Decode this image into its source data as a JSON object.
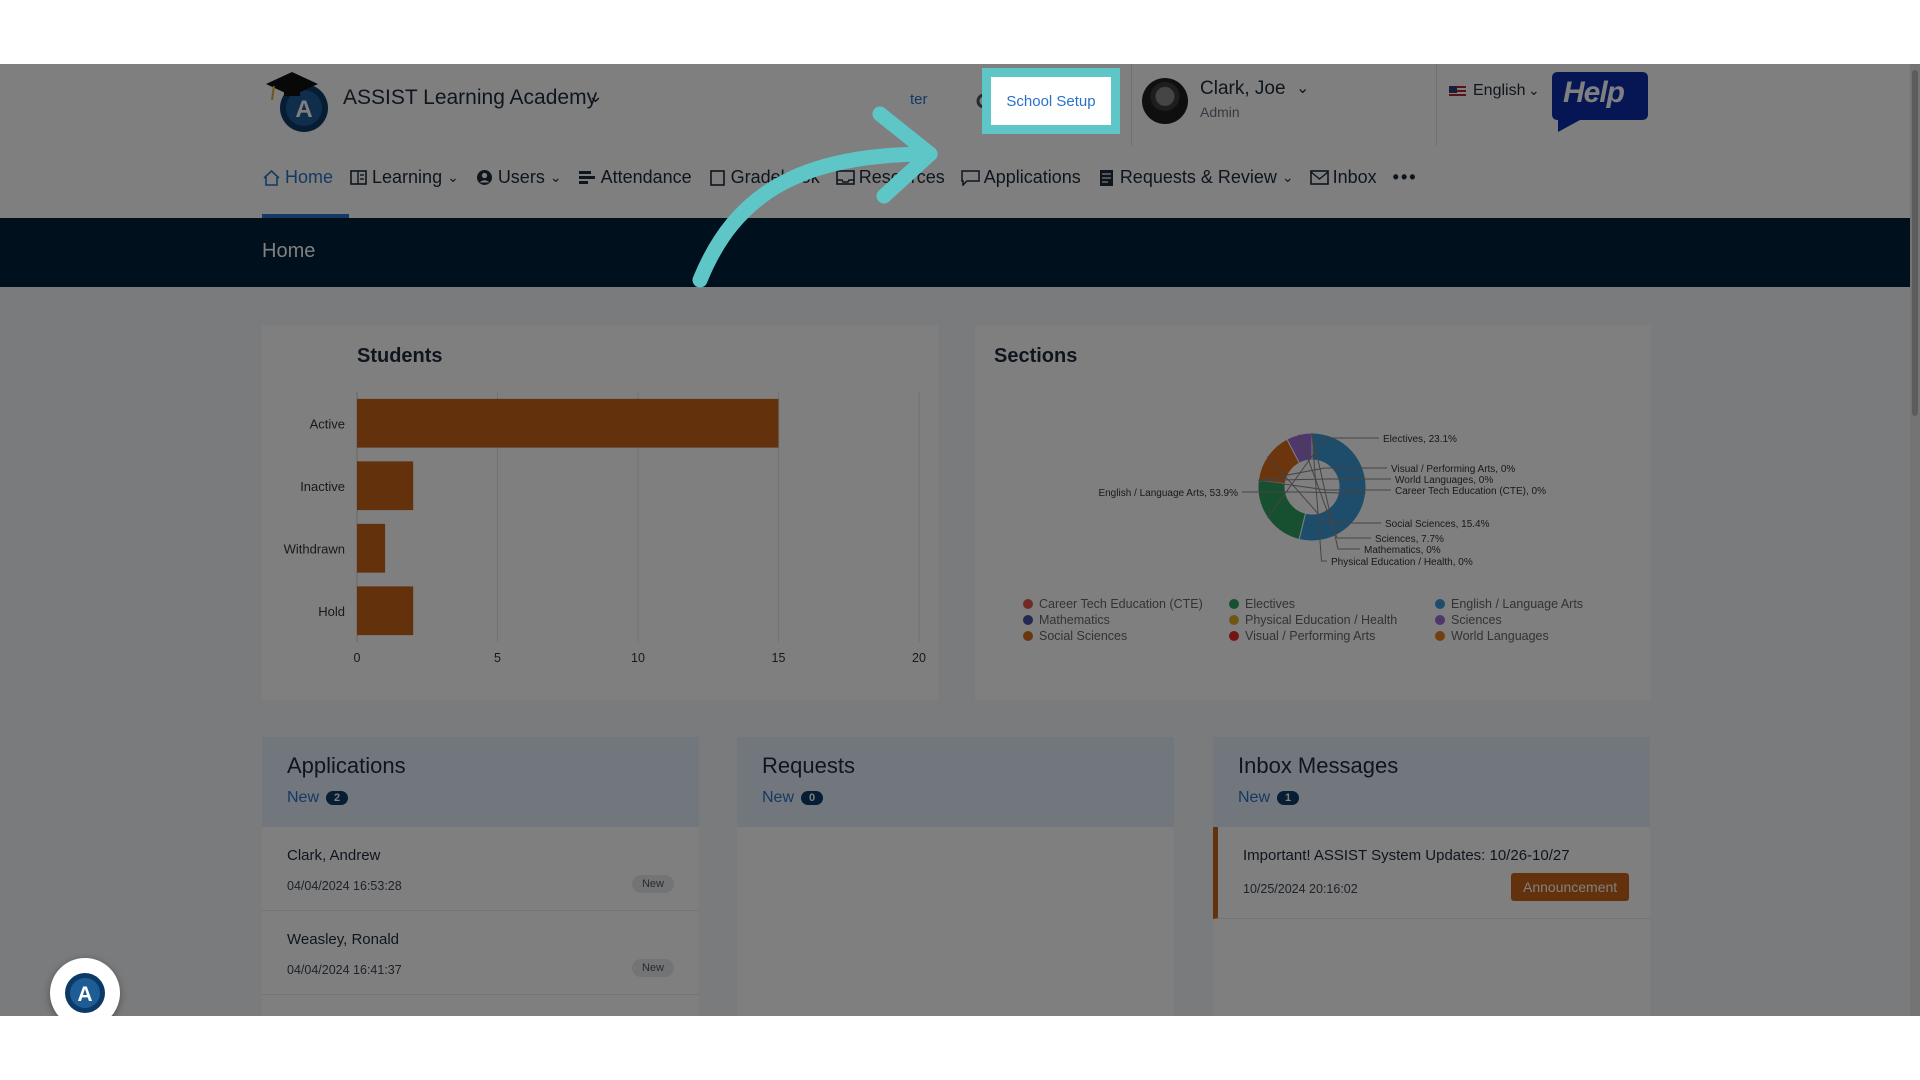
{
  "colors": {
    "accent": "#2a72c9",
    "banner": "#03203a",
    "bar": "#c8631a",
    "highlight": "#5fc6c8",
    "help_bg": "#0d2aa8"
  },
  "header": {
    "school_name": "ASSIST Learning Academy",
    "partial_link": "ter",
    "school_setup": "School Setup",
    "user_name": "Clark, Joe",
    "user_role": "Admin",
    "language": "English",
    "help": "Help"
  },
  "nav": {
    "items": [
      {
        "label": "Home",
        "icon": "home-icon"
      },
      {
        "label": "Learning",
        "icon": "grid-icon",
        "dropdown": true
      },
      {
        "label": "Users",
        "icon": "user-circle-icon",
        "dropdown": true
      },
      {
        "label": "Attendance",
        "icon": "bars-icon"
      },
      {
        "label": "Gradebook",
        "icon": "book-icon"
      },
      {
        "label": "Resources",
        "icon": "inbox-tray-icon"
      },
      {
        "label": "Applications",
        "icon": "chat-icon"
      },
      {
        "label": "Requests & Review",
        "icon": "document-icon",
        "dropdown": true
      },
      {
        "label": "Inbox",
        "icon": "mail-icon"
      }
    ],
    "more": "•••"
  },
  "banner": {
    "title": "Home"
  },
  "students": {
    "title": "Students",
    "chart_data": {
      "type": "bar",
      "orientation": "horizontal",
      "categories": [
        "Active",
        "Inactive",
        "Withdrawn",
        "Hold"
      ],
      "values": [
        15,
        2,
        1,
        2
      ],
      "xlim": [
        0,
        20
      ],
      "xticks": [
        "0",
        "5",
        "10",
        "15",
        "20"
      ],
      "grid": true,
      "color": "#c8631a"
    }
  },
  "sections": {
    "title": "Sections",
    "chart_data": {
      "type": "pie",
      "style": "donut",
      "slices": [
        {
          "name": "English / Language Arts",
          "value": 53.9,
          "label": "English / Language Arts, 53.9%",
          "color": "#3a9bd6"
        },
        {
          "name": "Electives",
          "value": 23.1,
          "label": "Electives, 23.1%",
          "color": "#2f9e63"
        },
        {
          "name": "Visual / Performing Arts",
          "value": 0,
          "label": "Visual / Performing Arts, 0%",
          "color": "#e62b2b"
        },
        {
          "name": "World Languages",
          "value": 0,
          "label": "World Languages, 0%",
          "color": "#e8811a"
        },
        {
          "name": "Career Tech Education (CTE)",
          "value": 0,
          "label": "Career Tech Education (CTE), 0%",
          "color": "#e4554a"
        },
        {
          "name": "Social Sciences",
          "value": 15.4,
          "label": "Social Sciences, 15.4%",
          "color": "#d86a1c"
        },
        {
          "name": "Sciences",
          "value": 7.7,
          "label": "Sciences, 7.7%",
          "color": "#9b6fd6"
        },
        {
          "name": "Mathematics",
          "value": 0,
          "label": "Mathematics, 0%",
          "color": "#4a4fa8"
        },
        {
          "name": "Physical Education / Health",
          "value": 0,
          "label": "Physical Education / Health, 0%",
          "color": "#e0ad2a"
        }
      ],
      "legend": [
        {
          "name": "Career Tech Education (CTE)",
          "color": "#e4554a"
        },
        {
          "name": "Electives",
          "color": "#2f9e63"
        },
        {
          "name": "English / Language Arts",
          "color": "#3a9bd6"
        },
        {
          "name": "Mathematics",
          "color": "#4a4fa8"
        },
        {
          "name": "Physical Education / Health",
          "color": "#e0ad2a"
        },
        {
          "name": "Sciences",
          "color": "#9b6fd6"
        },
        {
          "name": "Social Sciences",
          "color": "#d86a1c"
        },
        {
          "name": "Visual / Performing Arts",
          "color": "#e62b2b"
        },
        {
          "name": "World Languages",
          "color": "#e8811a"
        }
      ],
      "legend_position": "bottom"
    }
  },
  "applications": {
    "title": "Applications",
    "new_label": "New",
    "new_count": "2",
    "rows": [
      {
        "name": "Clark, Andrew",
        "date": "04/04/2024 16:53:28",
        "badge": "New"
      },
      {
        "name": "Weasley, Ronald",
        "date": "04/04/2024 16:41:37",
        "badge": "New"
      }
    ]
  },
  "requests": {
    "title": "Requests",
    "new_label": "New",
    "new_count": "0"
  },
  "inbox": {
    "title": "Inbox Messages",
    "new_label": "New",
    "new_count": "1",
    "message": {
      "subject": "Important! ASSIST System Updates: 10/26-10/27",
      "date": "10/25/2024 20:16:02",
      "badge": "Announcement"
    }
  }
}
